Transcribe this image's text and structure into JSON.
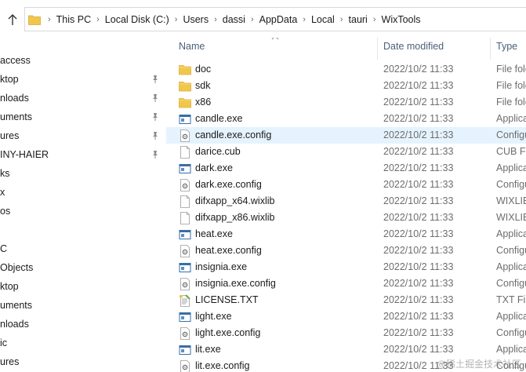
{
  "address": {
    "crumbs": [
      "This PC",
      "Local Disk (C:)",
      "Users",
      "dassi",
      "AppData",
      "Local",
      "tauri",
      "WixTools"
    ]
  },
  "nav": {
    "items": [
      {
        "label": "access",
        "pinned": false
      },
      {
        "label": "ktop",
        "pinned": true
      },
      {
        "label": "nloads",
        "pinned": true
      },
      {
        "label": "uments",
        "pinned": true
      },
      {
        "label": "ures",
        "pinned": true
      },
      {
        "label": "INY-HAIER",
        "pinned": true
      },
      {
        "label": "ks",
        "pinned": false
      },
      {
        "label": "x",
        "pinned": false
      },
      {
        "label": "os",
        "pinned": false
      },
      {
        "label": "",
        "pinned": false
      },
      {
        "label": "C",
        "pinned": false
      },
      {
        "label": "Objects",
        "pinned": false
      },
      {
        "label": "ktop",
        "pinned": false
      },
      {
        "label": "uments",
        "pinned": false
      },
      {
        "label": "nloads",
        "pinned": false
      },
      {
        "label": "ic",
        "pinned": false
      },
      {
        "label": "ures",
        "pinned": false
      }
    ]
  },
  "columns": {
    "name": "Name",
    "date": "Date modified",
    "type": "Type"
  },
  "files": [
    {
      "name": "doc",
      "date": "2022/10/2 11:33",
      "type": "File fold",
      "icon": "folder-icon"
    },
    {
      "name": "sdk",
      "date": "2022/10/2 11:33",
      "type": "File fold",
      "icon": "folder-icon"
    },
    {
      "name": "x86",
      "date": "2022/10/2 11:33",
      "type": "File fold",
      "icon": "folder-icon"
    },
    {
      "name": "candle.exe",
      "date": "2022/10/2 11:33",
      "type": "Applicat",
      "icon": "exe-icon"
    },
    {
      "name": "candle.exe.config",
      "date": "2022/10/2 11:33",
      "type": "Configu",
      "icon": "config-icon",
      "selected": true
    },
    {
      "name": "darice.cub",
      "date": "2022/10/2 11:33",
      "type": "CUB File",
      "icon": "file-icon"
    },
    {
      "name": "dark.exe",
      "date": "2022/10/2 11:33",
      "type": "Applicat",
      "icon": "exe-icon"
    },
    {
      "name": "dark.exe.config",
      "date": "2022/10/2 11:33",
      "type": "Configu",
      "icon": "config-icon"
    },
    {
      "name": "difxapp_x64.wixlib",
      "date": "2022/10/2 11:33",
      "type": "WIXLIB",
      "icon": "file-icon"
    },
    {
      "name": "difxapp_x86.wixlib",
      "date": "2022/10/2 11:33",
      "type": "WIXLIB",
      "icon": "file-icon"
    },
    {
      "name": "heat.exe",
      "date": "2022/10/2 11:33",
      "type": "Applicat",
      "icon": "exe-icon"
    },
    {
      "name": "heat.exe.config",
      "date": "2022/10/2 11:33",
      "type": "Configu",
      "icon": "config-icon"
    },
    {
      "name": "insignia.exe",
      "date": "2022/10/2 11:33",
      "type": "Applicat",
      "icon": "exe-icon"
    },
    {
      "name": "insignia.exe.config",
      "date": "2022/10/2 11:33",
      "type": "Configu",
      "icon": "config-icon"
    },
    {
      "name": "LICENSE.TXT",
      "date": "2022/10/2 11:33",
      "type": "TXT File",
      "icon": "txt-icon"
    },
    {
      "name": "light.exe",
      "date": "2022/10/2 11:33",
      "type": "Applicat",
      "icon": "exe-icon"
    },
    {
      "name": "light.exe.config",
      "date": "2022/10/2 11:33",
      "type": "Configu",
      "icon": "config-icon"
    },
    {
      "name": "lit.exe",
      "date": "2022/10/2 11:33",
      "type": "Applicat",
      "icon": "exe-icon"
    },
    {
      "name": "lit.exe.config",
      "date": "2022/10/2 11:33",
      "type": "Configu",
      "icon": "config-icon"
    }
  ],
  "watermark": "@稀土掘金技术社区",
  "colors": {
    "selected_row": "#e5f3ff",
    "folder": "#f0c74a",
    "header_text": "#4c607a",
    "muted_text": "#6d6d6d"
  }
}
